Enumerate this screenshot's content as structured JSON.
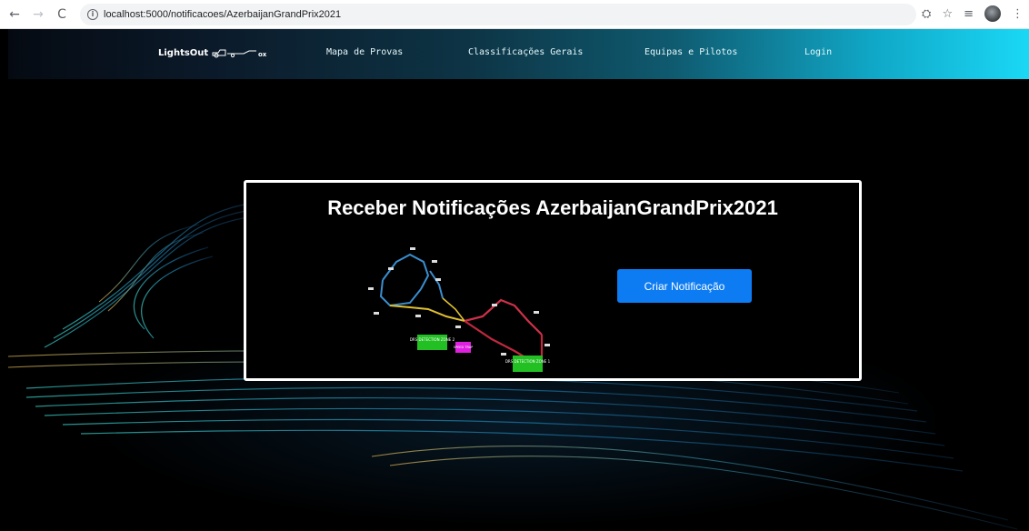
{
  "browser": {
    "url": "localhost:5000/notificacoes/AzerbaijanGrandPrix2021",
    "back_icon": "←",
    "forward_icon": "→",
    "reload_icon": "C",
    "info_icon": "i",
    "translate_icon": "⛭",
    "star_icon": "☆",
    "playlist_icon": "≡",
    "menu_icon": "⋮"
  },
  "navbar": {
    "brand": "LightsOut",
    "links": [
      {
        "label": "Mapa de Provas"
      },
      {
        "label": "Classificações Gerais"
      },
      {
        "label": "Equipas e Pilotos"
      },
      {
        "label": "Login"
      }
    ]
  },
  "card": {
    "title": "Receber Notificações AzerbaijanGrandPrix2021",
    "button_label": "Criar Notificação",
    "track_labels": {
      "zone1": "DRS DETECTION ZONE 1",
      "zone2": "DRS DETECTION ZONE 2",
      "speed_trap": "SPEED TRAP"
    }
  },
  "colors": {
    "accent": "#0d7cf2",
    "navbar_end": "#1ad8f5",
    "drs_green": "#22c022",
    "speed_trap_magenta": "#e020e0"
  }
}
